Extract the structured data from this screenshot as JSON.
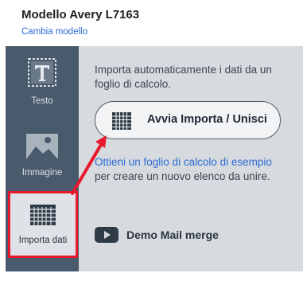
{
  "header": {
    "title": "Modello Avery L7163",
    "change_link": "Cambia modello"
  },
  "sidebar": {
    "items": [
      {
        "label": "Testo",
        "icon": "text-icon",
        "selected": false
      },
      {
        "label": "Immagine",
        "icon": "image-icon",
        "selected": false
      },
      {
        "label": "Importa dati",
        "icon": "spreadsheet-icon",
        "selected": true
      }
    ]
  },
  "panel": {
    "description": "Importa automaticamente i dati da un foglio di calcolo.",
    "import_button": "Avvia Importa / Unisci",
    "example_link": "Ottieni un foglio di calcolo di esempio",
    "example_rest": " per creare un nuovo elenco da unire.",
    "demo_link": "Demo Mail merge"
  },
  "colors": {
    "sidebar": "#4a5a6d",
    "panel": "#d7dbe0",
    "link": "#2c6bd2",
    "highlight": "#e8192c"
  }
}
